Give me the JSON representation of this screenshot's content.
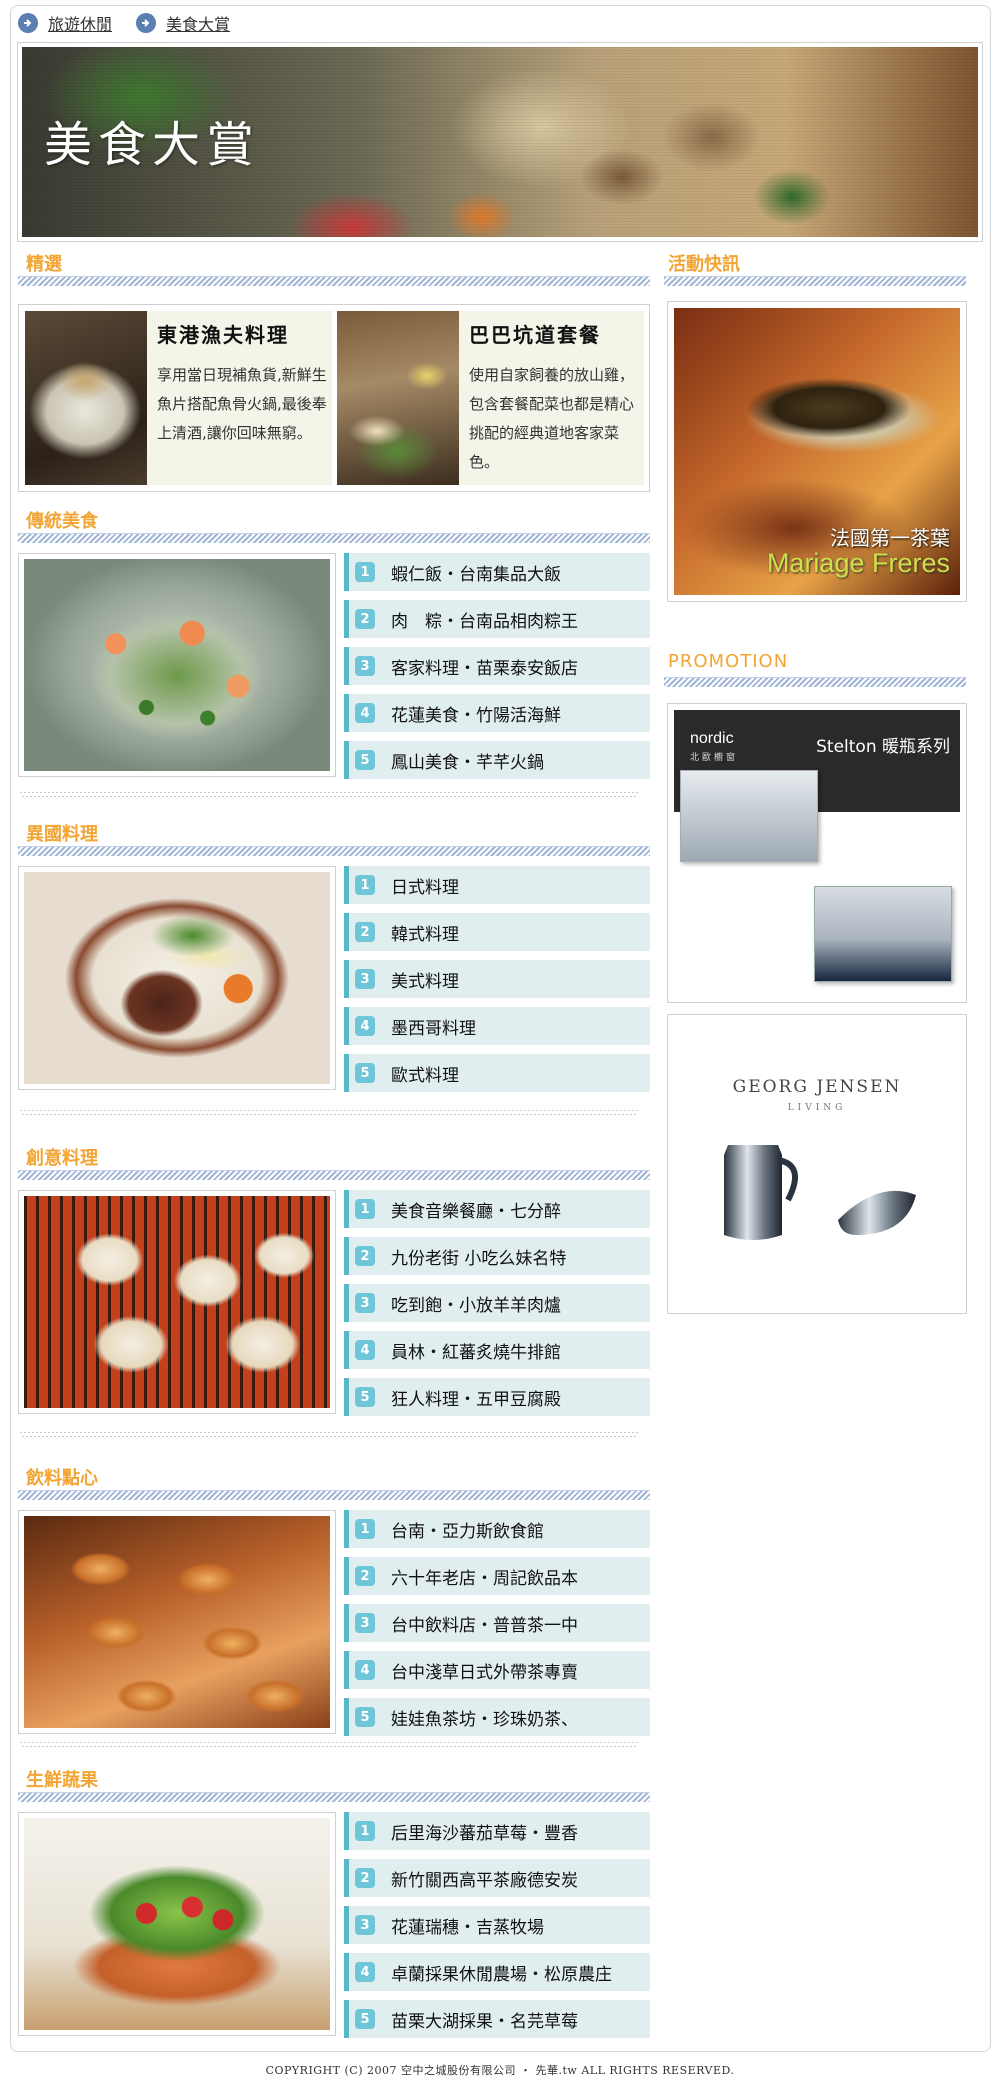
{
  "breadcrumb": [
    "旅遊休閒",
    "美食大賞"
  ],
  "hero": {
    "title": "美食大賞"
  },
  "featured": {
    "heading": "精選",
    "items": [
      {
        "title": "東港漁夫料理",
        "text": "享用當日現補魚貨,新鮮生魚片搭配魚骨火鍋,最後奉上清酒,讓你回味無窮。"
      },
      {
        "title": "巴巴坑道套餐",
        "text": "使用自家飼養的放山雞，包含套餐配菜也都是精心挑配的經典道地客家菜色。"
      }
    ]
  },
  "categories": [
    {
      "heading": "傳統美食",
      "items": [
        "蝦仁飯・台南集品大飯",
        "肉　粽・台南品相肉粽王",
        "客家料理・苗栗泰安飯店",
        "花蓮美食・竹陽活海鮮",
        "鳳山美食・芊芊火鍋"
      ]
    },
    {
      "heading": "異國料理",
      "items": [
        "日式料理",
        "韓式料理",
        "美式料理",
        "墨西哥料理",
        "歐式料理"
      ]
    },
    {
      "heading": "創意料理",
      "items": [
        "美食音樂餐廳・七分醉",
        "九份老街  小吃么妹名特",
        "吃到飽・小放羊羊肉爐",
        "員林・紅蕃炙燒牛排館",
        "狂人料理・五甲豆腐殿"
      ]
    },
    {
      "heading": "飲料點心",
      "items": [
        "台南・亞力斯飲食館",
        "六十年老店・周記飲品本",
        "台中飲料店・普普茶一中",
        "台中淺草日式外帶茶專賣",
        "娃娃魚茶坊・珍珠奶茶、"
      ]
    },
    {
      "heading": "生鮮蔬果",
      "items": [
        "后里海沙蕃茄草莓・豐香",
        "新竹關西高平茶廠德安炭",
        "花蓮瑞穗・吉蒸牧場",
        "卓蘭採果休閒農場・松原農庄",
        "苗栗大湖採果・名芫草莓"
      ]
    }
  ],
  "numbers": [
    "1",
    "2",
    "3",
    "4",
    "5"
  ],
  "sidebar": {
    "news_heading": "活動快訊",
    "tea_caption": "法國第一茶葉",
    "tea_brand": "Mariage Freres",
    "promo_heading": "PROMOTION",
    "nordic_logo": "nordic",
    "nordic_sub": "北歐櫥窗",
    "nordic_title": "Stelton 暖瓶系列",
    "georg_brand": "GEORG JENSEN",
    "georg_sub": "LIVING"
  },
  "footer": "COPYRIGHT (C) 2007 空中之城股份有限公司 ‧ 先華.tw ALL RIGHTS RESERVED."
}
